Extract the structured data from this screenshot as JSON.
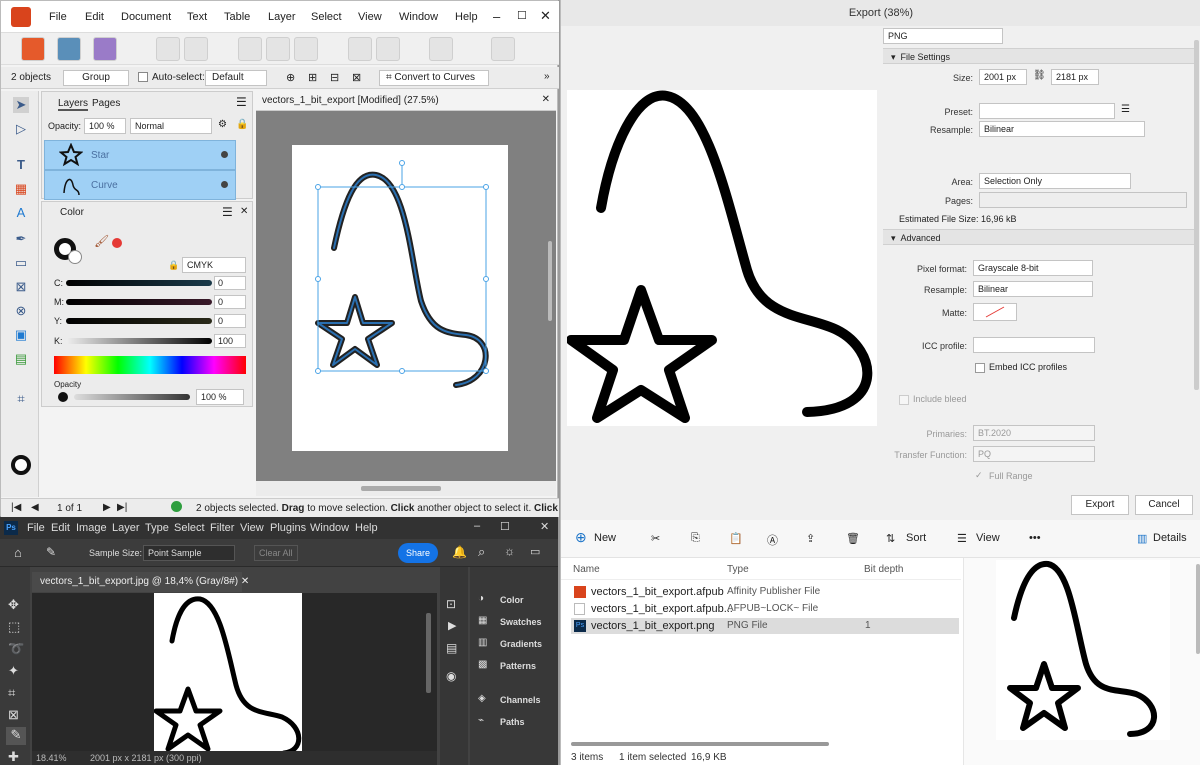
{
  "affinity": {
    "menu": [
      "File",
      "Edit",
      "Document",
      "Text",
      "Table",
      "Layer",
      "Select",
      "View",
      "Window",
      "Help"
    ],
    "context": {
      "selection_count": "2 objects",
      "group": "Group",
      "auto_select": "Auto-select:",
      "auto_select_value": "Default",
      "convert": "Convert to Curves"
    },
    "layers_panel": {
      "tab_layers": "Layers",
      "tab_pages": "Pages",
      "opacity_label": "Opacity:",
      "opacity": "100 %",
      "blend": "Normal",
      "items": [
        {
          "name": "Star"
        },
        {
          "name": "Curve"
        }
      ]
    },
    "color_panel": {
      "title": "Color",
      "mode": "CMYK",
      "channels": [
        {
          "label": "C:",
          "value": "0"
        },
        {
          "label": "M:",
          "value": "0"
        },
        {
          "label": "Y:",
          "value": "0"
        },
        {
          "label": "K:",
          "value": "100"
        }
      ],
      "opacity_label": "Opacity",
      "opacity": "100 %"
    },
    "doc_tab": "vectors_1_bit_export [Modified] (27.5%)",
    "status": {
      "page": "1 of 1",
      "message_pre": "2 objects selected.",
      "drag": "Drag",
      "message_mid": "to move selection.",
      "click": "Click",
      "message_post": "another object to select it.",
      "click2": "Click"
    }
  },
  "export": {
    "title": "Export (38%)",
    "format": "PNG",
    "file_settings": "File Settings",
    "size_label": "Size:",
    "width": "2001 px",
    "height": "2181 px",
    "preset_label": "Preset:",
    "preset": "",
    "resample_label": "Resample:",
    "resample": "Bilinear",
    "area_label": "Area:",
    "area": "Selection Only",
    "pages_label": "Pages:",
    "pages": "",
    "estimated": "Estimated File Size: 16,96 kB",
    "advanced": "Advanced",
    "pixel_format_label": "Pixel format:",
    "pixel_format": "Grayscale 8-bit",
    "resample2_label": "Resample:",
    "resample2": "Bilinear",
    "matte_label": "Matte:",
    "icc_label": "ICC profile:",
    "icc": "",
    "embed_icc": "Embed ICC profiles",
    "include_bleed": "Include bleed",
    "primaries_label": "Primaries:",
    "primaries": "BT.2020",
    "transfer_label": "Transfer Function:",
    "transfer": "PQ",
    "full_range": "Full Range",
    "export_button": "Export",
    "cancel_button": "Cancel"
  },
  "photoshop": {
    "menu": [
      "File",
      "Edit",
      "Image",
      "Layer",
      "Type",
      "Select",
      "Filter",
      "View",
      "Plugins",
      "Window",
      "Help"
    ],
    "sample_size_label": "Sample Size:",
    "sample_size": "Point Sample",
    "clear_all": "Clear All",
    "share": "Share",
    "doc_tab": "vectors_1_bit_export.jpg @ 18,4% (Gray/8#)",
    "zoom": "18.41%",
    "doc_info": "2001 px x 2181 px (300 ppi)",
    "panels": [
      "Color",
      "Swatches",
      "Gradients",
      "Patterns",
      "Channels",
      "Paths"
    ]
  },
  "explorer": {
    "toolbar": {
      "new": "New",
      "sort": "Sort",
      "view": "View",
      "more": "•••",
      "details": "Details"
    },
    "columns": {
      "name": "Name",
      "type": "Type",
      "bit_depth": "Bit depth"
    },
    "files": [
      {
        "name": "vectors_1_bit_export.afpub",
        "type": "Affinity Publisher File",
        "bit": ""
      },
      {
        "name": "vectors_1_bit_export.afpub...",
        "type": "AFPUB~LOCK~ File",
        "bit": ""
      },
      {
        "name": "vectors_1_bit_export.png",
        "type": "PNG File",
        "bit": "1"
      }
    ],
    "status": {
      "items": "3 items",
      "selected": "1 item selected",
      "size": "16,9 KB"
    }
  }
}
